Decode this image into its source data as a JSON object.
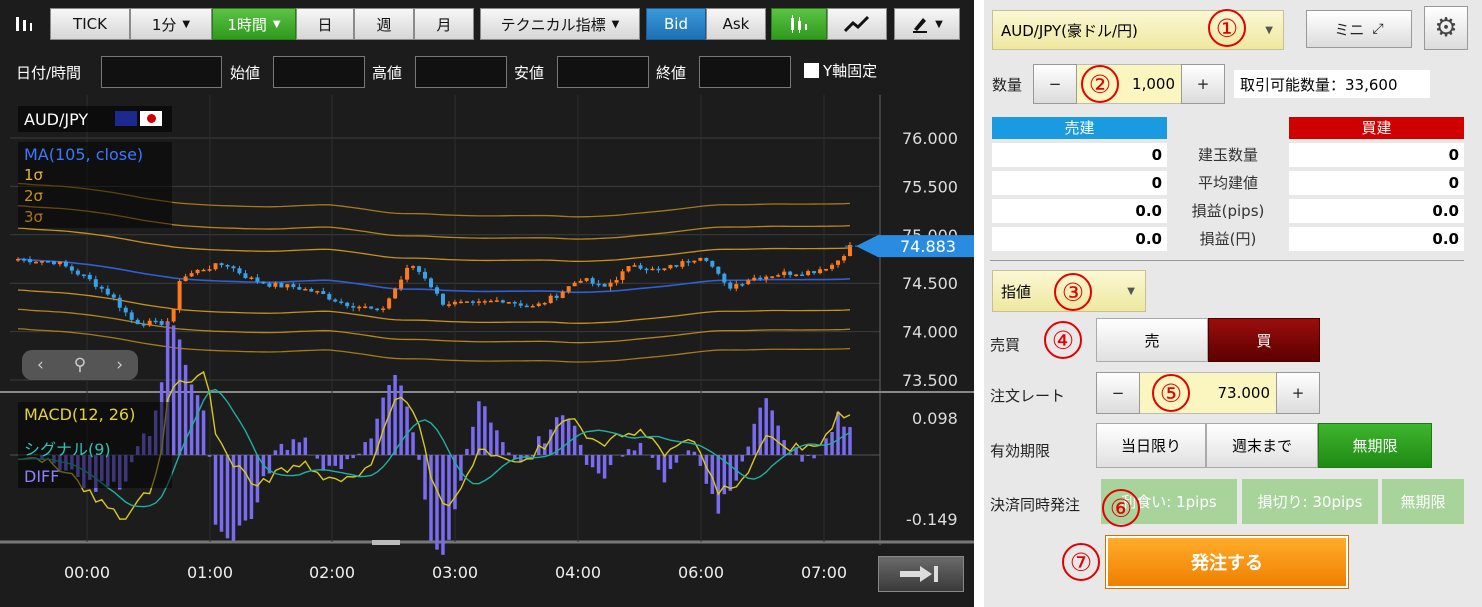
{
  "toolbar": {
    "tick": "TICK",
    "one_min": "1分",
    "one_hour": "1時間",
    "day": "日",
    "week": "週",
    "month": "月",
    "technical": "テクニカル指標",
    "bid": "Bid",
    "ask": "Ask"
  },
  "ohlc": {
    "datetime": "日付/時間",
    "open": "始値",
    "high": "高値",
    "low": "安値",
    "close": "終値",
    "y_fixed": "Y軸固定"
  },
  "chart": {
    "pair": "AUD/JPY",
    "ma_label": "MA(105, close)",
    "sigma1": "1σ",
    "sigma2": "2σ",
    "sigma3": "3σ",
    "price_ticks": [
      "76.000",
      "75.500",
      "75.000",
      "74.500",
      "74.000",
      "73.500"
    ],
    "current_price": "74.883",
    "macd_label": "MACD(12, 26)",
    "signal_label": "シグナル(9)",
    "diff_label": "DIFF",
    "macd_top": "0.098",
    "macd_bottom": "-0.149",
    "time_ticks": [
      "00:00",
      "01:00",
      "02:00",
      "03:00",
      "04:00",
      "06:00",
      "07:00"
    ],
    "colors": {
      "bg": "#1c1c1c",
      "up": "#ff7a1a",
      "down": "#3aa0e8",
      "ma": "#2f5fd0",
      "band": "#c8901e",
      "macd": "#d8c81e",
      "signal": "#1fb0a0",
      "diff": "#7a6cf0"
    },
    "icons": {
      "prev": "chevron-left-icon",
      "zoom": "magnifier-icon",
      "next": "chevron-right-icon",
      "jump": "jump-to-latest-icon"
    }
  },
  "order": {
    "symbol": "AUD/JPY(豪ドル/円)",
    "mini": "ミニ",
    "qty_label": "数量",
    "qty_minus": "−",
    "qty_value": "1,000",
    "qty_plus": "+",
    "tradable": "取引可能数量：33,600",
    "sell_header": "売建",
    "buy_header": "買建",
    "rows": [
      {
        "sell": "0",
        "label": "建玉数量",
        "buy": "0"
      },
      {
        "sell": "0",
        "label": "平均建値",
        "buy": "0"
      },
      {
        "sell": "0.0",
        "label": "損益(pips)",
        "buy": "0.0"
      },
      {
        "sell": "0.0",
        "label": "損益(円)",
        "buy": "0.0"
      }
    ],
    "order_type": "指値",
    "side_label": "売買",
    "sell": "売",
    "buy": "買",
    "rate_label": "注文レート",
    "rate_minus": "−",
    "rate_value": "73.000",
    "rate_plus": "+",
    "expiry_label": "有効期限",
    "expiry_today": "当日限り",
    "expiry_week": "週末まで",
    "expiry_none": "無期限",
    "oco_label": "決済同時発注",
    "take_profit": "利食い: 1pips",
    "stop_loss": "損切り: 30pips",
    "oco_none": "無期限",
    "submit": "発注する",
    "markers": [
      "①",
      "②",
      "③",
      "④",
      "⑤",
      "⑥",
      "⑦"
    ]
  }
}
